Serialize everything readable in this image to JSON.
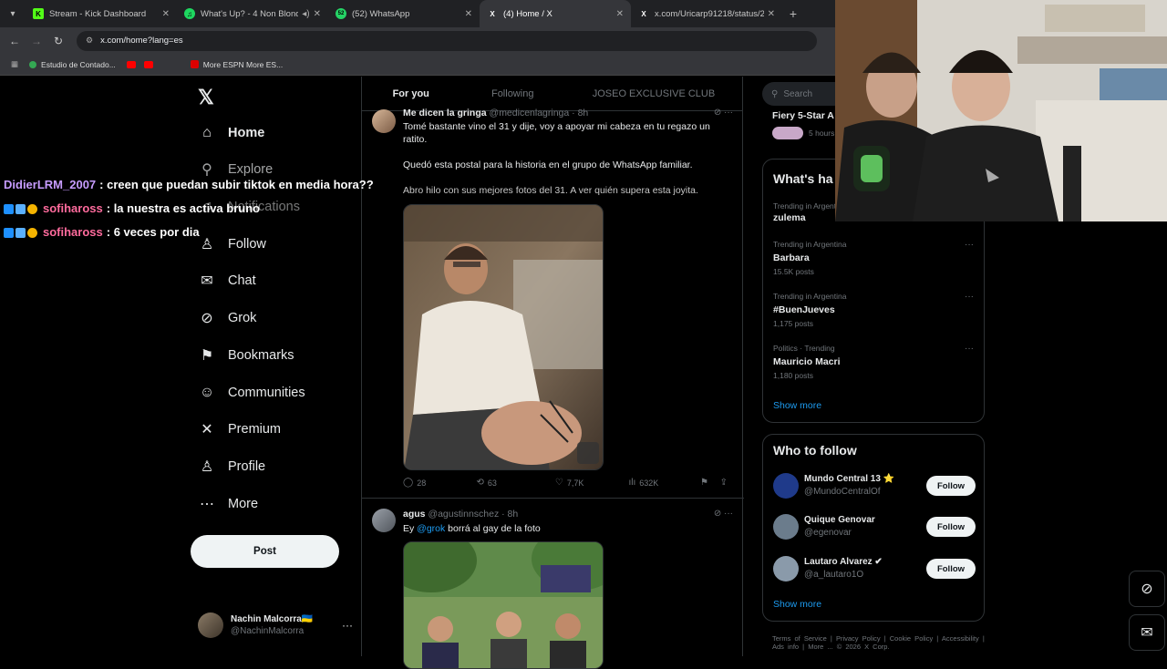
{
  "browser": {
    "tabs": [
      {
        "title": "Stream - Kick Dashboard",
        "color": "#53fc18",
        "glyph": "K"
      },
      {
        "title": "What's Up? - 4 Non Blonde",
        "color": "#1ed760",
        "glyph": "♫"
      },
      {
        "title": "(52) WhatsApp",
        "color": "#25d366",
        "glyph": "52"
      },
      {
        "title": "(4) Home / X",
        "color": "#ffffff",
        "glyph": "X"
      },
      {
        "title": "x.com/Uricarp91218/status/20",
        "color": "#ffffff",
        "glyph": "X"
      }
    ],
    "url": "x.com/home?lang=es",
    "bookmarks": [
      "Estudio de Contado...",
      "More ESPN More ES..."
    ]
  },
  "nav": {
    "items": [
      {
        "label": "Home",
        "icon": "home-icon",
        "glyph": "⌂"
      },
      {
        "label": "Explore",
        "icon": "search-icon",
        "glyph": "⚲"
      },
      {
        "label": "Notifications",
        "icon": "bell-icon",
        "glyph": "♫"
      },
      {
        "label": "Follow",
        "icon": "follow-icon",
        "glyph": "♙"
      },
      {
        "label": "Chat",
        "icon": "chat-icon",
        "glyph": "✉"
      },
      {
        "label": "Grok",
        "icon": "grok-icon",
        "glyph": "⊘"
      },
      {
        "label": "Bookmarks",
        "icon": "bookmark-icon",
        "glyph": "⚑"
      },
      {
        "label": "Communities",
        "icon": "communities-icon",
        "glyph": "☺"
      },
      {
        "label": "Premium",
        "icon": "premium-icon",
        "glyph": "✕"
      },
      {
        "label": "Profile",
        "icon": "profile-icon",
        "glyph": "♙"
      },
      {
        "label": "More",
        "icon": "more-icon",
        "glyph": "⋯"
      }
    ],
    "post_label": "Post",
    "account": {
      "name": "Nachin Malcorra🇺🇦",
      "handle": "@NachinMalcorra"
    }
  },
  "chat": [
    {
      "user": "DidierLRM_2007",
      "msg": ": creen que puedan subir tiktok en media hora??"
    },
    {
      "user": "sofihaross",
      "msg": ": la nuestra es activa bruno"
    },
    {
      "user": "sofihaross",
      "msg": ": 6 veces por dia"
    }
  ],
  "feed": {
    "tabs": [
      "For you",
      "Following",
      "JOSEO EXCLUSIVE CLUB"
    ],
    "tweet1": {
      "name": "Me dicen la gringa",
      "handle": "@medicenlagringa · 8h",
      "text1": "Tomé bastante vino el 31 y dije, voy a apoyar mi cabeza en tu regazo un ratito.",
      "text2": "Quedó esta postal para la historia en el grupo de WhatsApp familiar.",
      "text3": "Abro hilo con sus mejores fotos del 31. A ver quién supera esta joyita.",
      "replies": "28",
      "reposts": "63",
      "likes": "7,7K",
      "views": "632K"
    },
    "tweet2": {
      "name": "agus",
      "handle": "@agustinnschez · 8h",
      "text_pre": "Ey ",
      "mention": "@grok",
      "text_post": " borrá al gay de la foto"
    }
  },
  "right": {
    "search_placeholder": "Search",
    "top_partial_name": "Fiery 5-Star A",
    "top_partial_time": "5 hours",
    "whats_happening": "What's ha",
    "trends": [
      {
        "ctx": "Trending in Argentina",
        "name": "zulema",
        "count": ""
      },
      {
        "ctx": "Trending in Argentina",
        "name": "Barbara",
        "count": "15.5K posts"
      },
      {
        "ctx": "Trending in Argentina",
        "name": "#BuenJueves",
        "count": "1,175 posts"
      },
      {
        "ctx": "Politics · Trending",
        "name": "Mauricio Macri",
        "count": "1,180 posts"
      }
    ],
    "show_more": "Show more",
    "who_to_follow": "Who to follow",
    "follow_label": "Follow",
    "suggestions": [
      {
        "name": "Mundo Central 13 ⭐",
        "handle": "@MundoCentralOf",
        "color": "#1f3a8a"
      },
      {
        "name": "Quique Genovar",
        "handle": "@egenovar",
        "color": "#6b7c8c"
      },
      {
        "name": "Lautaro Alvarez ✔",
        "handle": "@a_lautaro1O",
        "color": "#8a9aaa"
      }
    ],
    "show_more2": "Show more",
    "footer": "Terms of Service | Privacy Policy | Cookie Policy | Accessibility | Ads info | More ... © 2026 X Corp."
  }
}
